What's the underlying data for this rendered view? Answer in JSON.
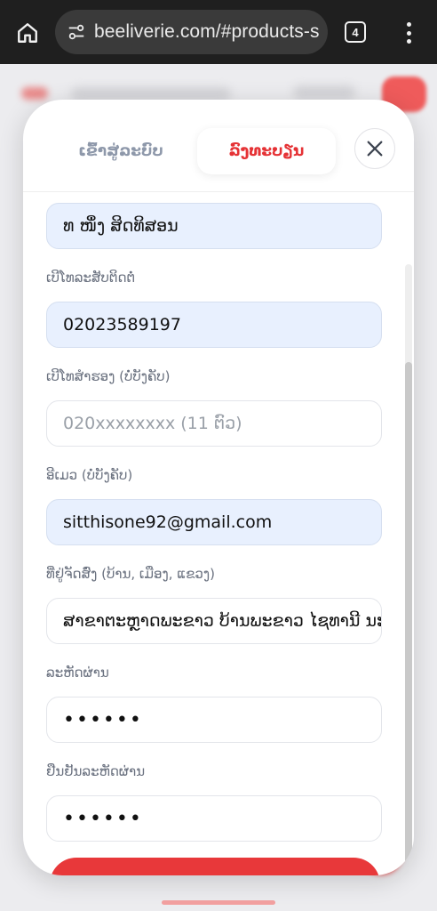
{
  "browser": {
    "url": "beeliverie.com/#products-s",
    "tab_count": "4"
  },
  "modal": {
    "tab_login": "ເຂົ້າສູ່ລະບົບ",
    "tab_register": "ລົງທະບຽນ",
    "fields": {
      "name_value": "ທ ໜຶ່ງ ສິດທິສອນ",
      "phone_label": "ເບີໂທລະສັບຕິດຕໍ່",
      "phone_value": "02023589197",
      "backup_phone_label": "ເບີໂທສຳຮອງ (ບໍ່ບັງຄັບ)",
      "backup_phone_placeholder": "020xxxxxxxx (11 ຕົວ)",
      "email_label": "ອີເມວ (ບໍ່ບັງຄັບ)",
      "email_value": "sitthisone92@gmail.com",
      "address_label": "ທີ່ຢູ່ຈັດສົ່ງ (ບ້ານ, ເມືອງ, ແຂວງ)",
      "address_value": "ສາຂາຕະຫຼາດພະຂາວ ບ້ານພະຂາວ ໄຊທານີ ນະຄອນຫຼວງ",
      "password_label": "ລະຫັດຜ່ານ",
      "password_value": "••••••",
      "confirm_password_label": "ຢືນຢັນລະຫັດຜ່ານ",
      "confirm_password_value": "••••••"
    }
  },
  "colors": {
    "accent": "#e53235",
    "input_filled_bg": "#e8f0fe",
    "browser_bar": "#1f1f1f"
  }
}
